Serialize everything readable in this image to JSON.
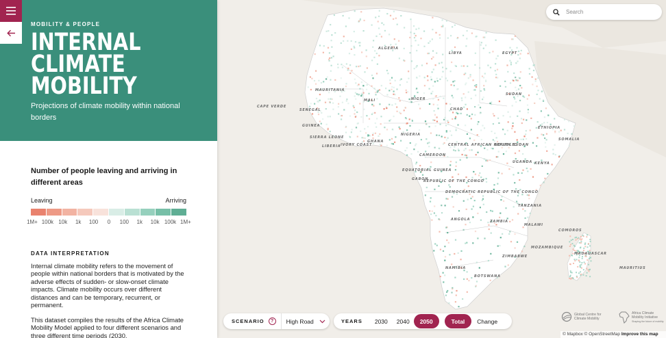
{
  "panel": {
    "eyebrow": "MOBILITY & PEOPLE",
    "title": "INTERNAL CLIMATE MOBILITY",
    "subtitle": "Projections of climate mobility within national borders",
    "menu_icon": "hamburger-icon",
    "back_icon": "arrow-left-icon",
    "hero_color": "#3a8f7b",
    "accent_color": "#a12450"
  },
  "legend": {
    "title": "Number of people leaving and arriving in different areas",
    "leaving_label": "Leaving",
    "arriving_label": "Arriving",
    "ticks": [
      "1M+",
      "100k",
      "10k",
      "1k",
      "100",
      "0",
      "100",
      "1k",
      "10k",
      "100k",
      "1M+"
    ],
    "colors": [
      "#e9826e",
      "#ee9a86",
      "#f2b3a2",
      "#f5c9bc",
      "#f8e2db",
      "#d9ede6",
      "#b9e0d3",
      "#96d0bd",
      "#77bfa7",
      "#5fae94"
    ]
  },
  "interpretation": {
    "heading": "DATA INTERPRETATION",
    "paragraph1": "Internal climate mobility refers to the movement of people within national borders that is motivated by the adverse effects of sudden- or slow-onset climate impacts. Climate mobility occurs over different distances and can be temporary, recurrent, or permanent.",
    "paragraph2": "This dataset compiles the results of the Africa Climate Mobility Model applied to four different scenarios and three different time periods (2030,"
  },
  "search": {
    "placeholder": "Search",
    "icon": "search-icon"
  },
  "scenario": {
    "label": "SCENARIO",
    "help": "?",
    "value": "High Road"
  },
  "years": {
    "label": "YEARS",
    "options": [
      "2030",
      "2040",
      "2050"
    ],
    "selected": "2050",
    "modes": [
      "Total",
      "Change"
    ],
    "selected_mode": "Total"
  },
  "logos": {
    "gccm": "Global Centre for Climate Mobility",
    "acmi": "Africa Climate Mobility Initiative",
    "acmi_tagline": "Shaping the future of mobility"
  },
  "attribution": {
    "text": "© Mapbox © OpenStreetMap",
    "link": "Improve this map"
  },
  "map": {
    "labels": [
      "ALGERIA",
      "LIBYA",
      "EGYPT",
      "MAURITANIA",
      "MALI",
      "NIGER",
      "CHAD",
      "SUDAN",
      "CAPE VERDE",
      "SENEGAL",
      "GUINEA",
      "SIERRA LEONE",
      "LIBERIA",
      "IVORY COAST",
      "GHANA",
      "NIGERIA",
      "CAMEROON",
      "CENTRAL AFRICAN REPUBLIC",
      "SOUTH SUDAN",
      "ETHIOPIA",
      "SOMALIA",
      "KENYA",
      "UGANDA",
      "EQUATORIAL GUINEA",
      "GABON",
      "REPUBLIC OF THE CONGO",
      "DEMOCRATIC REPUBLIC OF THE CONGO",
      "TANZANIA",
      "ANGOLA",
      "ZAMBIA",
      "MALAWI",
      "MOZAMBIQUE",
      "ZIMBABWE",
      "NAMIBIA",
      "BOTSWANA",
      "MADAGASCAR",
      "COMOROS",
      "MAURITIUS"
    ]
  }
}
